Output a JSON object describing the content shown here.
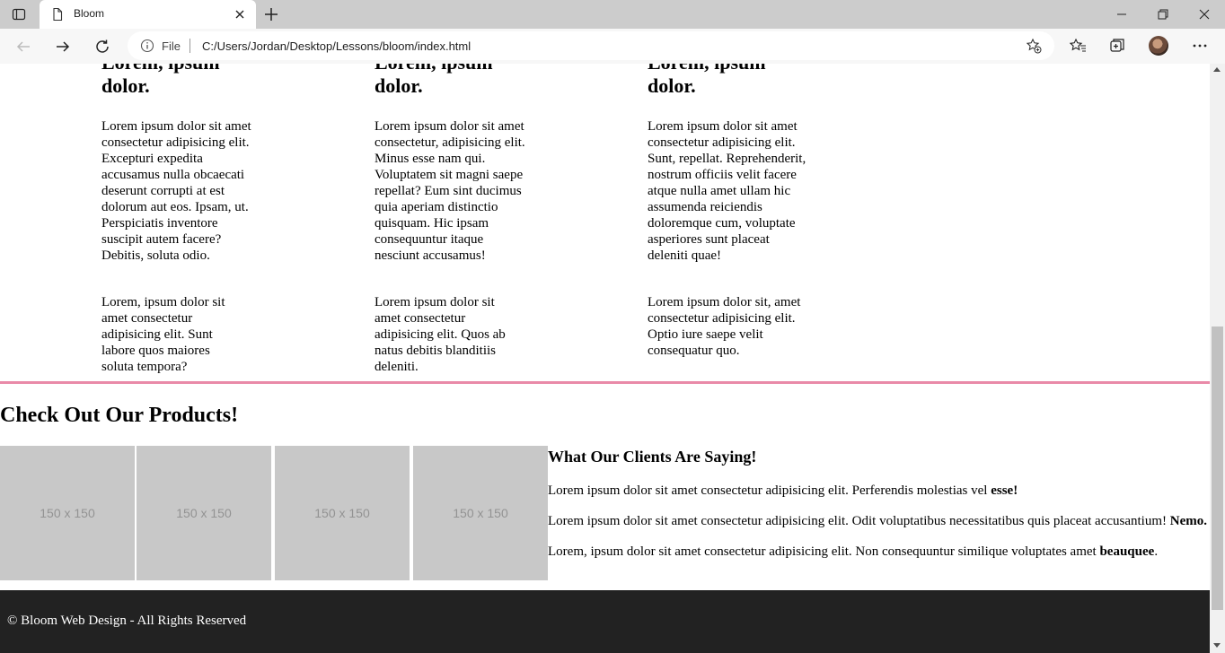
{
  "browser": {
    "tab_title": "Bloom",
    "file_label": "File",
    "url": "C:/Users/Jordan/Desktop/Lessons/bloom/index.html"
  },
  "columns": [
    {
      "heading": "Lorem, ipsum dolor.",
      "paragraphs": [
        "Lorem ipsum dolor sit amet consectetur adipisicing elit. Excepturi expedita accusamus nulla obcaecati deserunt corrupti at est dolorum aut eos. Ipsam, ut. Perspiciatis inventore suscipit autem facere? Debitis, soluta odio.",
        "Lorem, ipsum dolor sit amet consectetur adipisicing elit. Sunt labore quos maiores soluta tempora?"
      ]
    },
    {
      "heading": "Lorem, ipsum dolor.",
      "paragraphs": [
        "Lorem ipsum dolor sit amet consectetur, adipisicing elit. Minus esse nam qui. Voluptatem sit magni saepe repellat? Eum sint ducimus quia aperiam distinctio quisquam. Hic ipsam consequuntur itaque nesciunt accusamus!",
        "Lorem ipsum dolor sit amet consectetur adipisicing elit. Quos ab natus debitis blanditiis deleniti."
      ]
    },
    {
      "heading": "Lorem, ipsum dolor.",
      "paragraphs": [
        "Lorem ipsum dolor sit amet consectetur adipisicing elit. Sunt, repellat. Reprehenderit, nostrum officiis velit facere atque nulla amet ullam hic assumenda reiciendis doloremque cum, voluptate asperiores sunt placeat deleniti quae!",
        "Lorem ipsum dolor sit, amet consectetur adipisicing elit. Optio iure saepe velit consequatur quo."
      ]
    }
  ],
  "products": {
    "title": "Check Out Our Products!",
    "placeholders": [
      "150 x 150",
      "150 x 150",
      "150 x 150",
      "150 x 150"
    ]
  },
  "clients": {
    "title": "What Our Clients Are Saying!",
    "testimonials": [
      {
        "text": "Lorem ipsum dolor sit amet consectetur adipisicing elit. Perferendis molestias vel ",
        "name": "esse!",
        "after": ""
      },
      {
        "text": "Lorem ipsum dolor sit amet consectetur adipisicing elit. Odit voluptatibus necessitatibus quis placeat accusantium! ",
        "name": "Nemo.",
        "after": ""
      },
      {
        "text": "Lorem, ipsum dolor sit amet consectetur adipisicing elit. Non consequuntur similique voluptates amet ",
        "name": "beauquee",
        "after": "."
      }
    ]
  },
  "footer": {
    "text": "© Bloom Web Design - All Rights Reserved"
  }
}
